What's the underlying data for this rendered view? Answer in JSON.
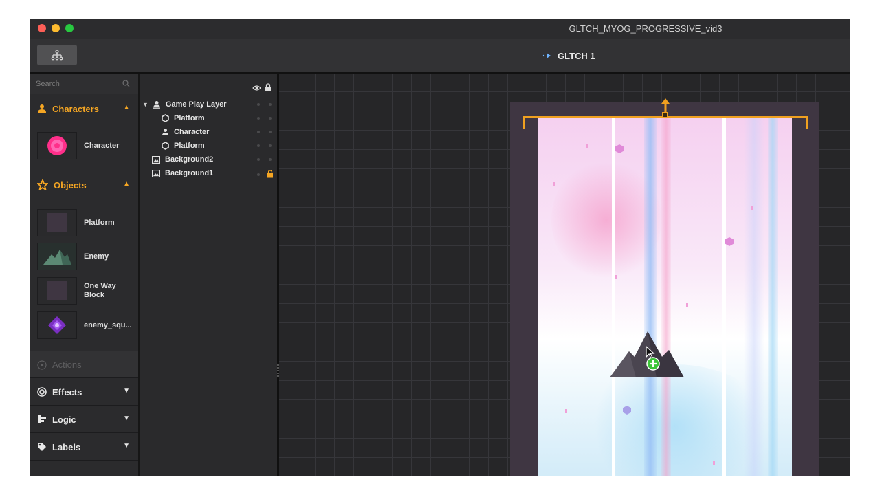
{
  "window": {
    "title": "GLTCH_MYOG_PROGRESSIVE_vid3",
    "traffic_colors": [
      "#fd5f57",
      "#fdbb2f",
      "#28c840"
    ]
  },
  "toolbar": {
    "hierarchy_icon": "hierarchy-icon",
    "scene_name": "GLTCH 1",
    "scene_icon": "play-arrow-icon"
  },
  "sidebar": {
    "search_placeholder": "Search",
    "characters": {
      "label": "Characters",
      "items": [
        {
          "label": "Character",
          "icon": "pink-orb"
        }
      ]
    },
    "objects": {
      "label": "Objects",
      "items": [
        {
          "label": "Platform",
          "icon": "square"
        },
        {
          "label": "Enemy",
          "icon": "mountain"
        },
        {
          "label": "One Way Block",
          "icon": "square"
        },
        {
          "label": "enemy_squ...",
          "icon": "purple-diamond"
        }
      ]
    },
    "actions_label": "Actions",
    "effects_label": "Effects",
    "logic_label": "Logic",
    "labels_label": "Labels"
  },
  "layers": {
    "rows": [
      {
        "name": "Game Play Layer",
        "icon": "person-layer-icon"
      },
      {
        "name": "Platform",
        "icon": "hexagon-icon"
      },
      {
        "name": "Character",
        "icon": "person-icon"
      },
      {
        "name": "Platform",
        "icon": "hexagon-icon"
      },
      {
        "name": "Background2",
        "icon": "image-icon"
      },
      {
        "name": "Background1",
        "icon": "image-icon",
        "locked": true
      }
    ]
  },
  "colors": {
    "accent": "#f5a623",
    "selection": "#f0a020"
  }
}
